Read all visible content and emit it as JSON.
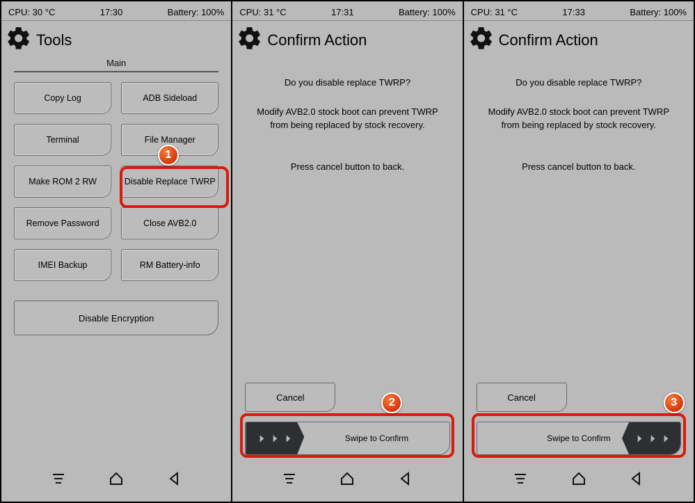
{
  "panels": [
    {
      "status": {
        "cpu": "CPU: 30 °C",
        "time": "17:30",
        "battery": "Battery: 100%"
      },
      "header": "Tools",
      "subheader": "Main",
      "buttons": [
        "Copy Log",
        "ADB Sideload",
        "Terminal",
        "File Manager",
        "Make ROM 2 RW",
        "Disable Replace TWRP",
        "Remove Password",
        "Close AVB2.0",
        "IMEI Backup",
        "RM Battery-info"
      ],
      "wide_button": "Disable Encryption"
    },
    {
      "status": {
        "cpu": "CPU: 31 °C",
        "time": "17:31",
        "battery": "Battery: 100%"
      },
      "header": "Confirm Action",
      "question": "Do you disable replace TWRP?",
      "body1": "Modify AVB2.0 stock boot can prevent TWRP from being replaced by stock recovery.",
      "body2": "Press cancel button to back.",
      "cancel": "Cancel",
      "swipe": "Swipe to Confirm"
    },
    {
      "status": {
        "cpu": "CPU: 31 °C",
        "time": "17:33",
        "battery": "Battery: 100%"
      },
      "header": "Confirm Action",
      "question": "Do you disable replace TWRP?",
      "body1": "Modify AVB2.0 stock boot can prevent TWRP from being replaced by stock recovery.",
      "body2": "Press cancel button to back.",
      "cancel": "Cancel",
      "swipe": "Swipe to Confirm"
    }
  ],
  "markers": {
    "m1": "1",
    "m2": "2",
    "m3": "3"
  }
}
